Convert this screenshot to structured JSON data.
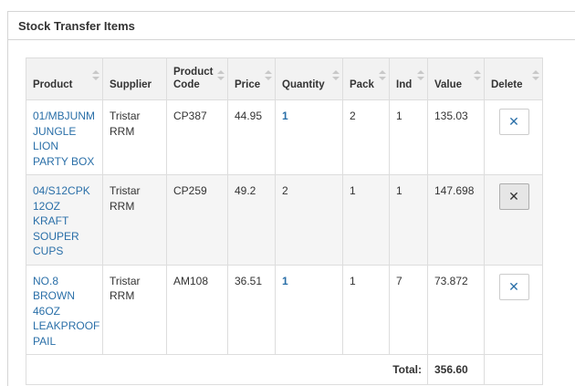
{
  "panel": {
    "title": "Stock Transfer Items"
  },
  "table": {
    "columns": [
      {
        "key": "product",
        "label": "Product"
      },
      {
        "key": "supplier",
        "label": "Supplier"
      },
      {
        "key": "product_code",
        "label": "Product Code"
      },
      {
        "key": "price",
        "label": "Price"
      },
      {
        "key": "quantity",
        "label": "Quantity"
      },
      {
        "key": "pack",
        "label": "Pack"
      },
      {
        "key": "ind",
        "label": "Ind"
      },
      {
        "key": "value",
        "label": "Value"
      },
      {
        "key": "delete",
        "label": "Delete"
      }
    ],
    "rows": [
      {
        "product": "01/MBJUNM JUNGLE LION PARTY BOX",
        "supplier": "Tristar RRM",
        "product_code": "CP387",
        "price": "44.95",
        "quantity": "1",
        "pack": "2",
        "ind": "1",
        "value": "135.03",
        "delete_icon": "close-icon"
      },
      {
        "product": "04/S12CPK 12OZ KRAFT SOUPER CUPS",
        "supplier": "Tristar RRM",
        "product_code": "CP259",
        "price": "49.2",
        "quantity": "2",
        "pack": "1",
        "ind": "1",
        "value": "147.698",
        "delete_icon": "close-icon"
      },
      {
        "product": "NO.8 BROWN 46OZ LEAKPROOF PAIL",
        "supplier": "Tristar RRM",
        "product_code": "AM108",
        "price": "36.51",
        "quantity": "1",
        "pack": "1",
        "ind": "7",
        "value": "73.872",
        "delete_icon": "close-icon"
      }
    ],
    "total_label": "Total:",
    "total_value": "356.60",
    "delete_symbol": "✕"
  },
  "colors": {
    "link": "#2a6fa8",
    "header_bg": "#f2f2f2",
    "border": "#dddddd"
  }
}
